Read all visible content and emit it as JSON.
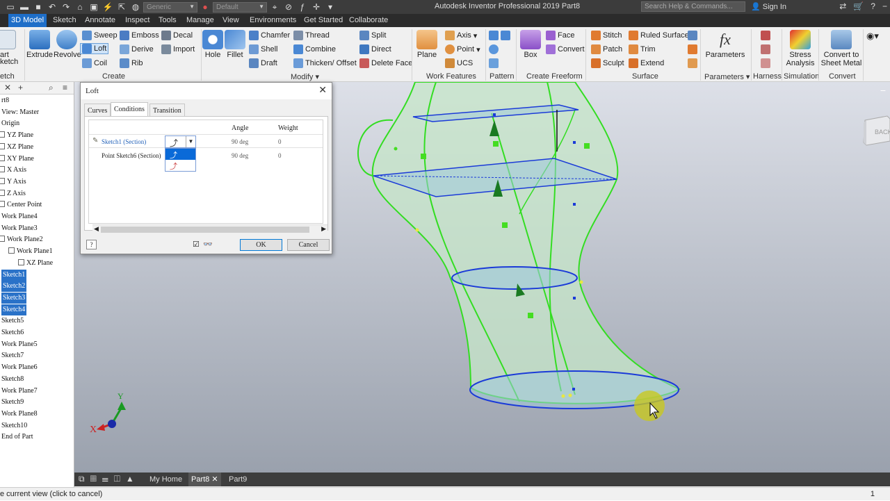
{
  "app": {
    "title": "Autodesk Inventor Professional 2019    Part8",
    "qat": {
      "appearance": "Generic",
      "material": "Default"
    },
    "search_placeholder": "Search Help & Commands...",
    "sign_in": "Sign In"
  },
  "tabs": [
    "3D Model",
    "Sketch",
    "Annotate",
    "Inspect",
    "Tools",
    "Manage",
    "View",
    "Environments",
    "Get Started",
    "Collaborate"
  ],
  "ribbon": {
    "sketch": {
      "line1": "art",
      "line2": "ketch",
      "panel": "etch"
    },
    "create": {
      "extrude": "Extrude",
      "revolve": "Revolve",
      "sweep": "Sweep",
      "loft": "Loft",
      "coil": "Coil",
      "emboss": "Emboss",
      "derive": "Derive",
      "rib": "Rib",
      "decal": "Decal",
      "import": "Import",
      "panel": "Create"
    },
    "modify": {
      "hole": "Hole",
      "fillet": "Fillet",
      "chamfer": "Chamfer",
      "shell": "Shell",
      "draft": "Draft",
      "thread": "Thread",
      "combine": "Combine",
      "thicken": "Thicken/ Offset",
      "split": "Split",
      "direct": "Direct",
      "delete_face": "Delete Face",
      "panel": "Modify"
    },
    "work_features": {
      "plane": "Plane",
      "axis": "Axis",
      "point": "Point",
      "ucs": "UCS",
      "panel": "Work Features"
    },
    "pattern": {
      "panel": "Pattern"
    },
    "freeform": {
      "box": "Box",
      "face": "Face",
      "convert": "Convert",
      "panel": "Create Freeform"
    },
    "surface": {
      "stitch": "Stitch",
      "patch": "Patch",
      "sculpt": "Sculpt",
      "ruled": "Ruled Surface",
      "trim": "Trim",
      "extend": "Extend",
      "panel": "Surface"
    },
    "parameters": {
      "label": "Parameters",
      "panel": "Parameters"
    },
    "harness": {
      "panel": "Harness"
    },
    "simulation": {
      "stress1": "Stress",
      "stress2": "Analysis",
      "panel": "Simulation"
    },
    "convert": {
      "label1": "Convert to",
      "label2": "Sheet Metal",
      "panel": "Convert"
    }
  },
  "browser": {
    "items": [
      {
        "label": "rt8",
        "sel": false,
        "indent": 0
      },
      {
        "label": "View: Master",
        "sel": false,
        "indent": 0
      },
      {
        "label": "Origin",
        "sel": false,
        "indent": 0
      },
      {
        "label": "YZ Plane",
        "sel": false,
        "indent": 1
      },
      {
        "label": "XZ Plane",
        "sel": false,
        "indent": 1
      },
      {
        "label": "XY Plane",
        "sel": false,
        "indent": 1
      },
      {
        "label": "X Axis",
        "sel": false,
        "indent": 1
      },
      {
        "label": "Y Axis",
        "sel": false,
        "indent": 1
      },
      {
        "label": "Z Axis",
        "sel": false,
        "indent": 1
      },
      {
        "label": "Center Point",
        "sel": false,
        "indent": 1
      },
      {
        "label": "Work Plane4",
        "sel": false,
        "indent": 0
      },
      {
        "label": "Work Plane3",
        "sel": false,
        "indent": 0
      },
      {
        "label": "Work Plane2",
        "sel": false,
        "indent": 2
      },
      {
        "label": "Work Plane1",
        "sel": false,
        "indent": 3
      },
      {
        "label": "XZ Plane",
        "sel": false,
        "indent": 4
      },
      {
        "label": "Sketch1",
        "sel": true,
        "indent": 0
      },
      {
        "label": "Sketch2",
        "sel": true,
        "indent": 0
      },
      {
        "label": "Sketch3",
        "sel": true,
        "indent": 0
      },
      {
        "label": "Sketch4",
        "sel": true,
        "indent": 0
      },
      {
        "label": "Sketch5",
        "sel": false,
        "indent": 0
      },
      {
        "label": "Sketch6",
        "sel": false,
        "indent": 0
      },
      {
        "label": "Work Plane5",
        "sel": false,
        "indent": 0
      },
      {
        "label": "Sketch7",
        "sel": false,
        "indent": 0
      },
      {
        "label": "Work Plane6",
        "sel": false,
        "indent": 0
      },
      {
        "label": "Sketch8",
        "sel": false,
        "indent": 0
      },
      {
        "label": "Work Plane7",
        "sel": false,
        "indent": 0
      },
      {
        "label": "Sketch9",
        "sel": false,
        "indent": 0
      },
      {
        "label": "Work Plane8",
        "sel": false,
        "indent": 0
      },
      {
        "label": "Sketch10",
        "sel": false,
        "indent": 0
      },
      {
        "label": "End of Part",
        "sel": false,
        "indent": 0
      }
    ]
  },
  "dialog": {
    "title": "Loft",
    "tabs": [
      "Curves",
      "Conditions",
      "Transition"
    ],
    "columns": {
      "angle": "Angle",
      "weight": "Weight"
    },
    "rows": [
      {
        "name": "Sketch1 (Section)",
        "angle": "90 deg",
        "weight": "0"
      },
      {
        "name": "Point Sketch6 (Section)",
        "angle": "90 deg",
        "weight": "0"
      }
    ],
    "ok": "OK",
    "cancel": "Cancel"
  },
  "doc_tabs": {
    "home": "My Home",
    "part8": "Part8",
    "part9": "Part9"
  },
  "viewcube": {
    "face": "BACK"
  },
  "triad": {
    "x": "X",
    "y": "Y"
  },
  "status": {
    "text": "e current view (click to cancel)",
    "count": "1"
  }
}
